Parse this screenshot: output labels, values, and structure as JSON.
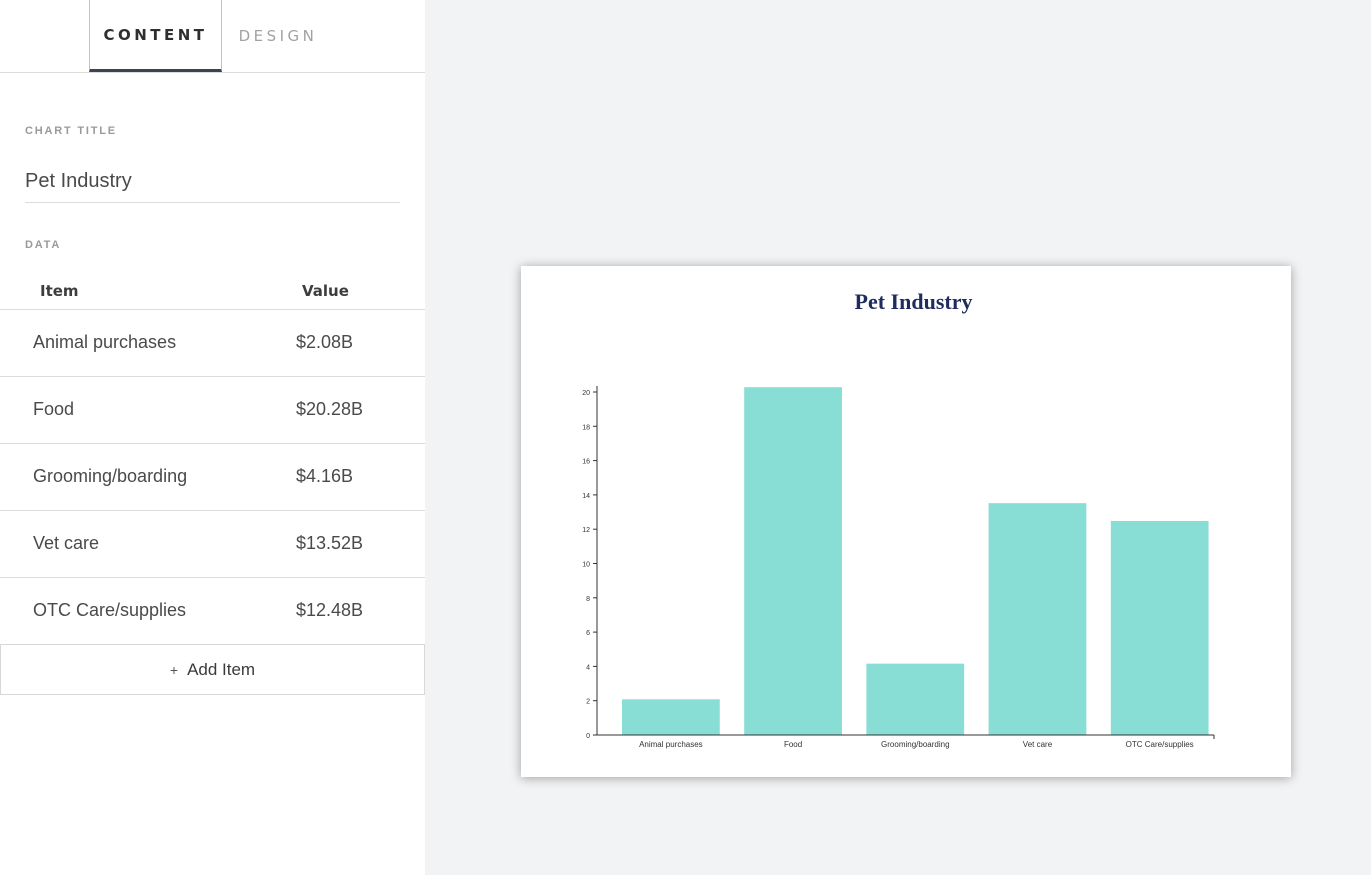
{
  "tabs": {
    "content": "CONTENT",
    "design": "DESIGN"
  },
  "content": {
    "chart_title_label": "CHART TITLE",
    "chart_title_value": "Pet Industry",
    "data_label": "DATA",
    "columns": {
      "item": "Item",
      "value": "Value"
    },
    "rows": [
      {
        "item": "Animal purchases",
        "value": "$2.08B"
      },
      {
        "item": "Food",
        "value": "$20.28B"
      },
      {
        "item": "Grooming/boarding",
        "value": "$4.16B"
      },
      {
        "item": "Vet care",
        "value": "$13.52B"
      },
      {
        "item": "OTC Care/supplies",
        "value": "$12.48B"
      }
    ],
    "add_item": "Add Item",
    "add_icon": "+"
  },
  "colors": {
    "bar": "#88ddd5",
    "title": "#1f2d5c",
    "axis": "#333333"
  },
  "chart_data": {
    "type": "bar",
    "title": "Pet Industry",
    "categories": [
      "Animal purchases",
      "Food",
      "Grooming/boarding",
      "Vet care",
      "OTC Care/supplies"
    ],
    "values": [
      2.08,
      20.28,
      4.16,
      13.52,
      12.48
    ],
    "ylim": [
      0,
      20
    ],
    "yticks": [
      0,
      2,
      4,
      6,
      8,
      10,
      12,
      14,
      16,
      18,
      20
    ],
    "grid": false,
    "xlabel": "",
    "ylabel": ""
  }
}
